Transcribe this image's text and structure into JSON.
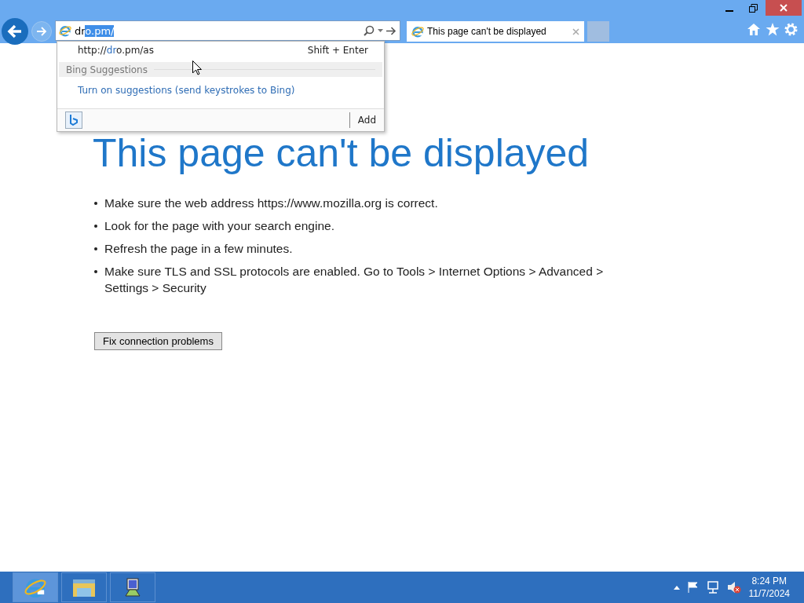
{
  "address_bar": {
    "typed": "dr",
    "completion": "o.pm/"
  },
  "tabs": [
    {
      "label": "This page can't be displayed",
      "selected": true
    }
  ],
  "autocomplete": {
    "suggestion": {
      "prefix": "http://",
      "match": "dr",
      "rest": "o.pm/as",
      "shortcut": "Shift + Enter"
    },
    "section": "Bing Suggestions",
    "link": "Turn on suggestions (send keystrokes to Bing)",
    "add": "Add"
  },
  "page": {
    "heading": "This page can't be displayed",
    "bullets": [
      "Make sure the web address https://www.mozilla.org is correct.",
      "Look for the page with your search engine.",
      "Refresh the page in a few minutes.",
      "Make sure TLS and SSL protocols are enabled. Go to Tools > Internet Options > Advanced > Settings > Security"
    ],
    "button": "Fix connection problems"
  },
  "taskbar": {
    "apps": [
      {
        "kind": "ie",
        "selected": true
      },
      {
        "kind": "folder",
        "selected": false
      },
      {
        "kind": "computer",
        "selected": false
      }
    ],
    "time": "8:24 PM",
    "date": "11/7/2024"
  }
}
